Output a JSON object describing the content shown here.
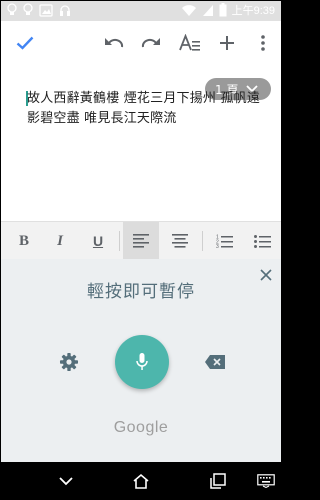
{
  "status_bar": {
    "time": "上午9:39",
    "icons": [
      "lightbulb-icon",
      "lightbulb-icon",
      "image-icon",
      "bluetooth-headset-icon",
      "wifi-icon",
      "signal-icon",
      "battery-icon"
    ]
  },
  "toolbar": {
    "done_icon": "check-icon",
    "undo_icon": "undo-icon",
    "redo_icon": "redo-icon",
    "format_icon": "text-format-icon",
    "insert_icon": "plus-icon",
    "more_icon": "more-vertical-icon"
  },
  "document": {
    "text": "故人西辭黃鶴樓 煙花三月下揚州 孤帆遠影碧空盡 唯見長江天際流",
    "page_indicator": "1 頁"
  },
  "format_bar": {
    "items": [
      "bold",
      "italic",
      "underline",
      "align-left",
      "align-center",
      "numbered-list",
      "bulleted-list"
    ],
    "bold_label": "B",
    "italic_label": "I",
    "underline_label": "U"
  },
  "voice_input": {
    "title": "輕按即可暫停",
    "brand": "Google"
  },
  "colors": {
    "accent": "#4db6ac",
    "primary_blue": "#4285f4",
    "panel_bg": "#eceff1"
  }
}
